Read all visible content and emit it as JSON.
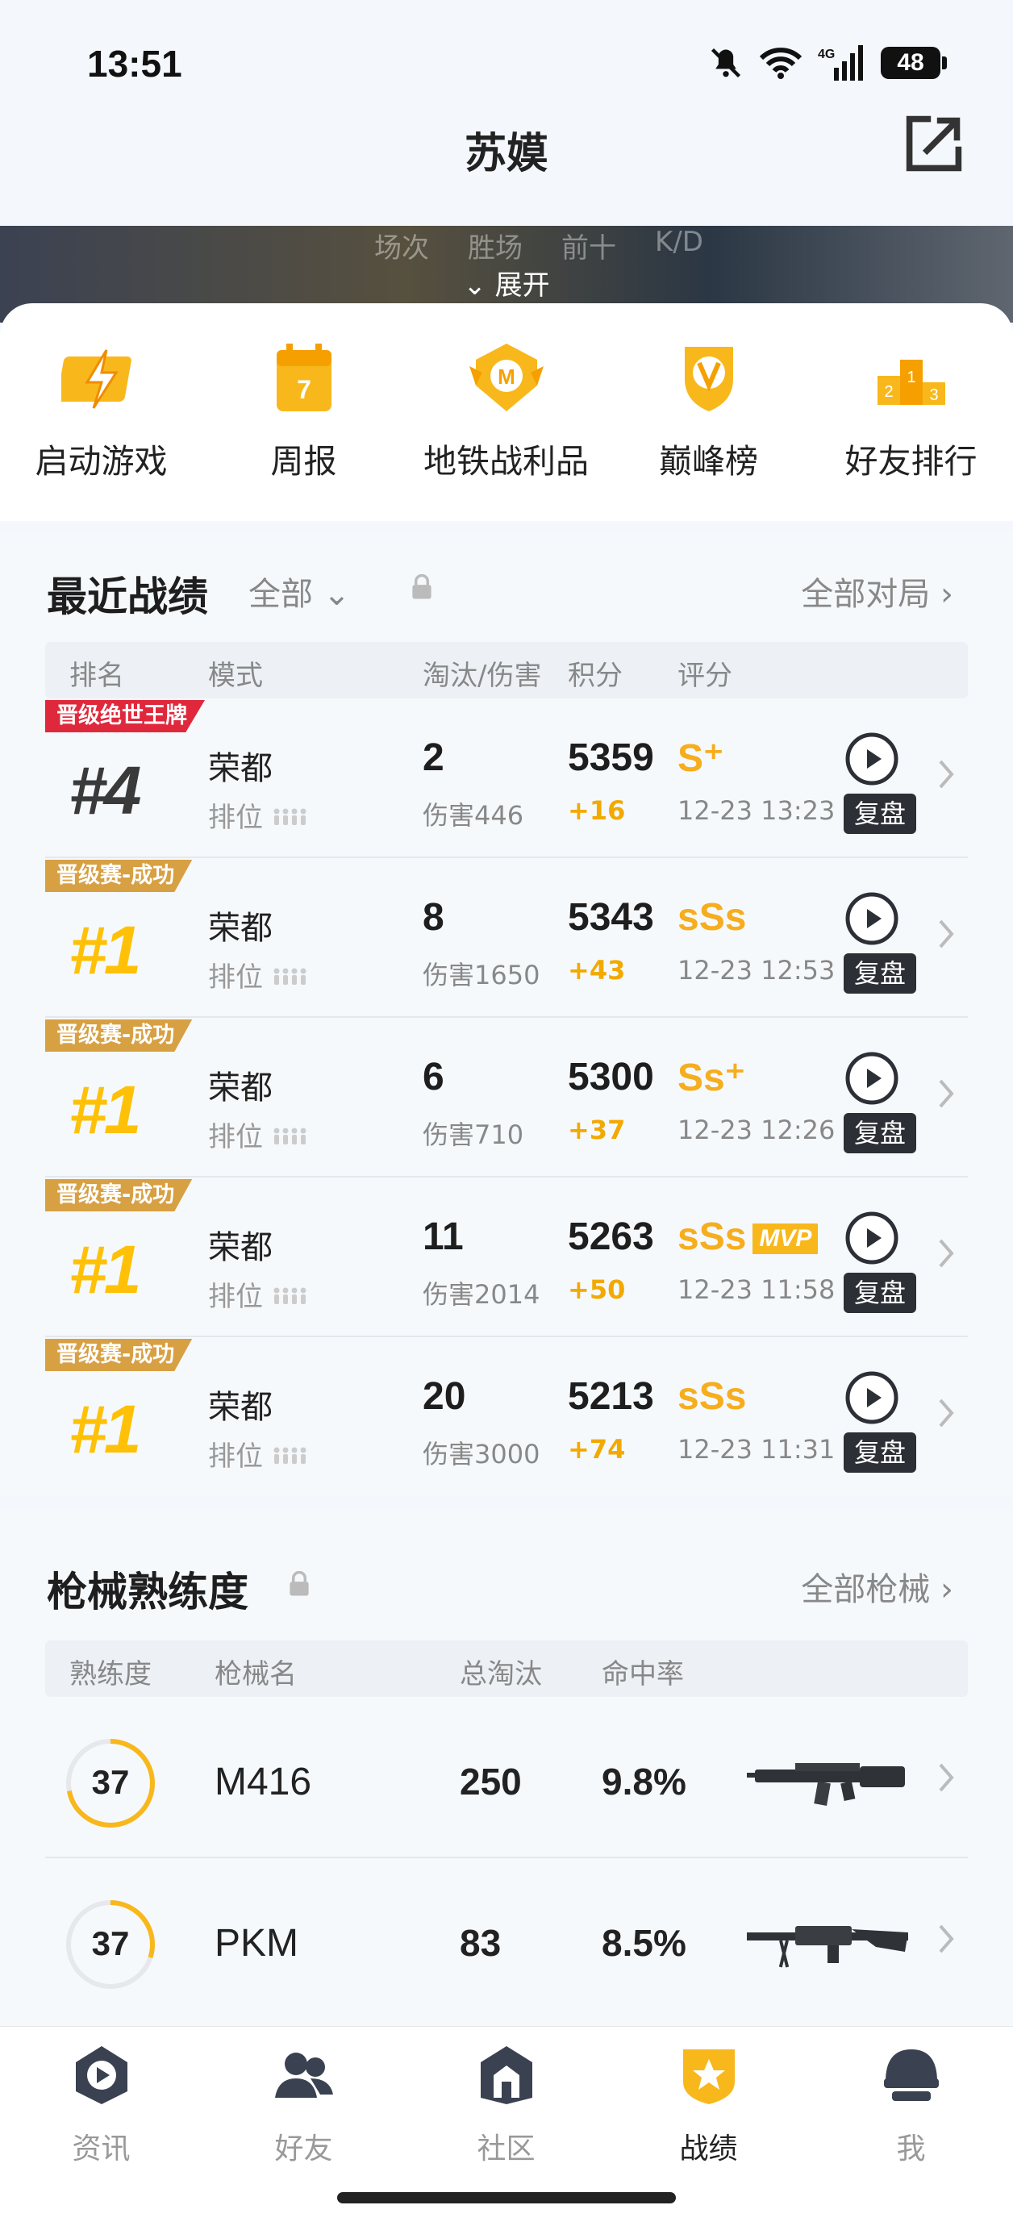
{
  "status": {
    "time": "13:51",
    "battery": "48",
    "network": "4G"
  },
  "header": {
    "title": "苏嫫"
  },
  "banner": {
    "labels": [
      "场次",
      "胜场",
      "前十",
      "K/D"
    ],
    "expand": "展开"
  },
  "quick": [
    {
      "label": "启动游戏",
      "icon": "lightning-icon"
    },
    {
      "label": "周报",
      "icon": "calendar-icon",
      "badge": "7"
    },
    {
      "label": "地铁战利品",
      "icon": "metro-badge-icon"
    },
    {
      "label": "巅峰榜",
      "icon": "trophy-icon"
    },
    {
      "label": "好友排行",
      "icon": "podium-icon"
    }
  ],
  "recent": {
    "title": "最近战绩",
    "filter": "全部",
    "more": "全部对局",
    "headers": {
      "rank": "排名",
      "mode": "模式",
      "kills": "淘汰/伤害",
      "score": "积分",
      "grade": "评分"
    },
    "replay_label": "复盘",
    "rows": [
      {
        "tag": "晋级绝世王牌",
        "tag_color": "#e0283c",
        "rank": "#4",
        "mode": "荣都",
        "mode_sub": "排位",
        "kills": "2",
        "damage": "伤害446",
        "score": "5359",
        "delta": "+16",
        "grade": "S⁺",
        "mvp": "",
        "time": "12-23 13:23"
      },
      {
        "tag": "晋级赛-成功",
        "tag_color": "#d7a043",
        "rank": "#1",
        "mode": "荣都",
        "mode_sub": "排位",
        "kills": "8",
        "damage": "伤害1650",
        "score": "5343",
        "delta": "+43",
        "grade": "sSs",
        "mvp": "",
        "time": "12-23 12:53"
      },
      {
        "tag": "晋级赛-成功",
        "tag_color": "#d7a043",
        "rank": "#1",
        "mode": "荣都",
        "mode_sub": "排位",
        "kills": "6",
        "damage": "伤害710",
        "score": "5300",
        "delta": "+37",
        "grade": "Ss⁺",
        "mvp": "",
        "time": "12-23 12:26"
      },
      {
        "tag": "晋级赛-成功",
        "tag_color": "#d7a043",
        "rank": "#1",
        "mode": "荣都",
        "mode_sub": "排位",
        "kills": "11",
        "damage": "伤害2014",
        "score": "5263",
        "delta": "+50",
        "grade": "sSs",
        "mvp": "MVP",
        "time": "12-23 11:58"
      },
      {
        "tag": "晋级赛-成功",
        "tag_color": "#d7a043",
        "rank": "#1",
        "mode": "荣都",
        "mode_sub": "排位",
        "kills": "20",
        "damage": "伤害3000",
        "score": "5213",
        "delta": "+74",
        "grade": "sSs",
        "mvp": "",
        "time": "12-23 11:31"
      }
    ]
  },
  "weapons": {
    "title": "枪械熟练度",
    "more": "全部枪械",
    "headers": {
      "level": "熟练度",
      "name": "枪械名",
      "kills": "总淘汰",
      "rate": "命中率"
    },
    "rows": [
      {
        "level": "37",
        "progress": 0.72,
        "name": "M416",
        "kills": "250",
        "rate": "9.8%"
      },
      {
        "level": "37",
        "progress": 0.3,
        "name": "PKM",
        "kills": "83",
        "rate": "8.5%"
      }
    ]
  },
  "tabs": [
    {
      "label": "资讯",
      "icon": "news-icon",
      "active": false
    },
    {
      "label": "好友",
      "icon": "friends-icon",
      "active": false
    },
    {
      "label": "社区",
      "icon": "community-icon",
      "active": false
    },
    {
      "label": "战绩",
      "icon": "record-icon",
      "active": true
    },
    {
      "label": "我",
      "icon": "helmet-icon",
      "active": false
    }
  ],
  "colors": {
    "accent": "#f6ad1e",
    "gold_tag": "#d7a043",
    "red_tag": "#e0283c"
  }
}
